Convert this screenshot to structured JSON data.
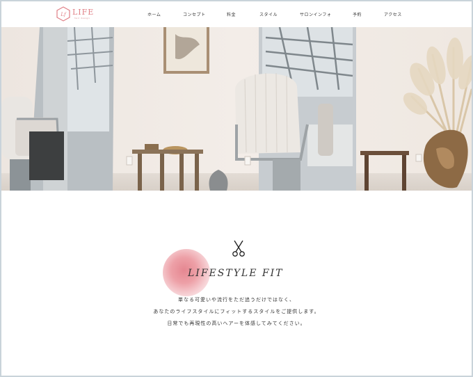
{
  "header": {
    "logo_text": "LIFE",
    "logo_sub": "hair design",
    "logo_color": "#e07f86",
    "nav": [
      "ホーム",
      "コンセプト",
      "料金",
      "スタイル",
      "サロンインフォ",
      "予約",
      "アクセス"
    ]
  },
  "hero": {
    "image_icon": "salon-interior-photo"
  },
  "intro": {
    "icon": "scissors-icon",
    "tagline": "LIFESTYLE FIT",
    "accent_color": "#e58791",
    "lines": [
      "単なる可愛いや流行をただ追うだけではなく、",
      "あなたのライフスタイルにフィットするスタイルをご提供します。",
      "日常でも再現性の高いヘアーを体感してみてください。"
    ]
  }
}
